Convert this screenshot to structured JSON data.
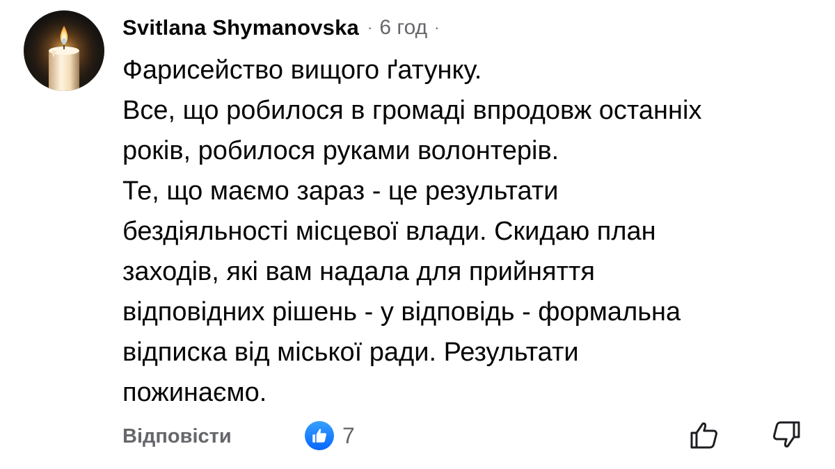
{
  "comment": {
    "author": "Svitlana Shymanovska",
    "separator": "·",
    "time": "6 год",
    "trailing_separator": "·",
    "avatar_icon": "candle-icon",
    "lines": [
      "Фарисейство вищого ґатунку.",
      "Все, що робилося в громаді впродовж останніх",
      "років, робилося руками волонтерів.",
      "Те, що маємо зараз - це результати",
      "бездіяльності місцевої влади. Скидаю план",
      "заходів, які вам надала для прийняття",
      "відповідних рішень - у відповідь - формальна",
      "відписка від міської ради. Результати",
      "пожинаємо."
    ]
  },
  "actions": {
    "reply_label": "Відповісти",
    "like_icon": "like-thumb-icon",
    "like_count": "7",
    "upvote_icon": "thumbs-up-outline-icon",
    "downvote_icon": "thumbs-down-outline-icon"
  },
  "colors": {
    "text_primary": "#050505",
    "text_secondary": "#65676b",
    "like_blue": "#0866ff"
  }
}
